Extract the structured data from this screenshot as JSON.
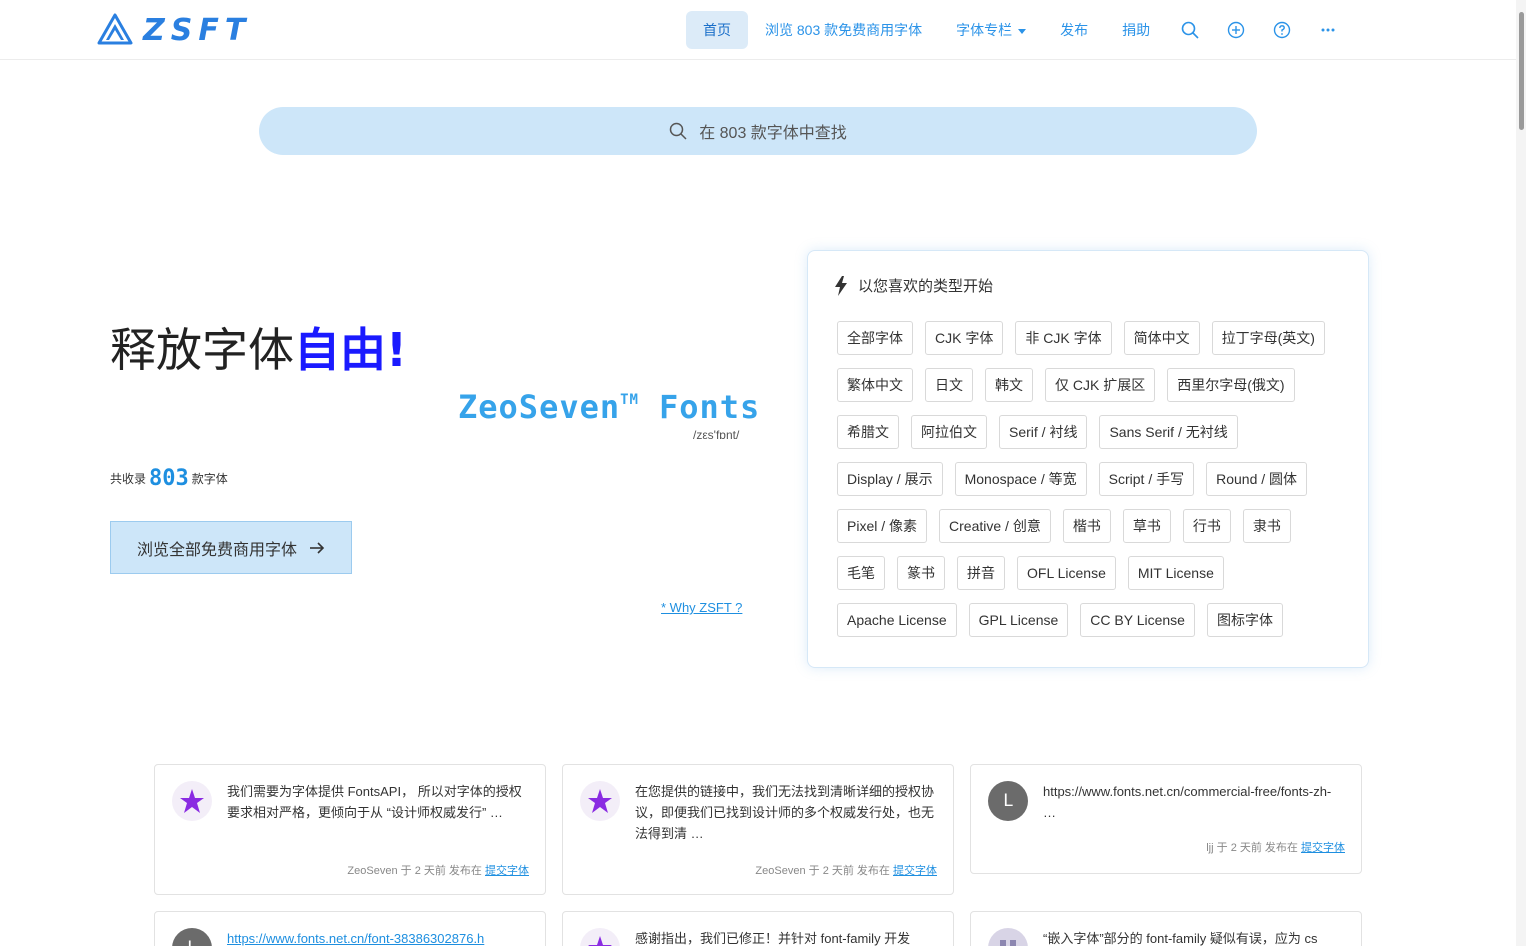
{
  "header": {
    "logo_text": "ZSFT",
    "nav": [
      {
        "label": "首页",
        "active": true
      },
      {
        "label": "浏览 803 款免费商用字体"
      },
      {
        "label": "字体专栏",
        "dropdown": true
      },
      {
        "label": "发布"
      },
      {
        "label": "捐助"
      }
    ],
    "icons": [
      "search-icon",
      "add-circle-icon",
      "help-icon",
      "more-icon"
    ]
  },
  "search": {
    "placeholder": "在 803 款字体中查找"
  },
  "hero": {
    "title_prefix": "释放字体",
    "title_accent": "自由",
    "title_suffix": "!",
    "brand": "ZeoSeven",
    "brand_tm": "TM",
    "brand_fonts": "Fonts",
    "phonetic": "/zεs'fɒnt/",
    "count_prefix": "共收录",
    "count": "803",
    "count_suffix": "款字体",
    "browse_button": "浏览全部免费商用字体",
    "why_link": "* Why ZSFT ?"
  },
  "categories": {
    "heading": "以您喜欢的类型开始",
    "tags": [
      "全部字体",
      "CJK 字体",
      "非 CJK 字体",
      "简体中文",
      "拉丁字母(英文)",
      "繁体中文",
      "日文",
      "韩文",
      "仅 CJK 扩展区",
      "西里尔字母(俄文)",
      "希腊文",
      "阿拉伯文",
      "Serif / 衬线",
      "Sans Serif / 无衬线",
      "Display / 展示",
      "Monospace / 等宽",
      "Script / 手写",
      "Round / 圆体",
      "Pixel / 像素",
      "Creative / 创意",
      "楷书",
      "草书",
      "行书",
      "隶书",
      "毛笔",
      "篆书",
      "拼音",
      "OFL License",
      "MIT License",
      "Apache License",
      "GPL License",
      "CC BY License",
      "图标字体"
    ]
  },
  "comments": [
    {
      "avatar": "star",
      "text": "我们需要为字体提供 FontsAPI， 所以对字体的授权要求相对严格，更倾向于从 “设计师权威发行” …",
      "author": "ZeoSeven",
      "time": "于 2 天前 发布在",
      "where": "提交字体"
    },
    {
      "avatar": "star",
      "text": "在您提供的链接中，我们无法找到清晰详细的授权协议，即便我们已找到设计师的多个权威发行处，也无法得到清 …",
      "author": "ZeoSeven",
      "time": "于 2 天前 发布在",
      "where": "提交字体"
    },
    {
      "avatar": "letter",
      "letter": "L",
      "text": "https://www.fonts.net.cn/commercial-free/fonts-zh- …",
      "author": "ljj",
      "time": "于 2 天前 发布在",
      "where": "提交字体"
    },
    {
      "avatar": "letter",
      "letter": "L",
      "text": "https://www.fonts.net.cn/font-38386302876.h"
    },
    {
      "avatar": "star",
      "text": "感谢指出，我们已修正！并针对 font-family 开发"
    },
    {
      "avatar": "pattern",
      "text": "“嵌入字体”部分的 font-family 疑似有误，应为 cs"
    }
  ],
  "colors": {
    "accent": "#1e8fe0",
    "search_bg": "#cde6f9",
    "title_accent": "#1a1aff"
  }
}
